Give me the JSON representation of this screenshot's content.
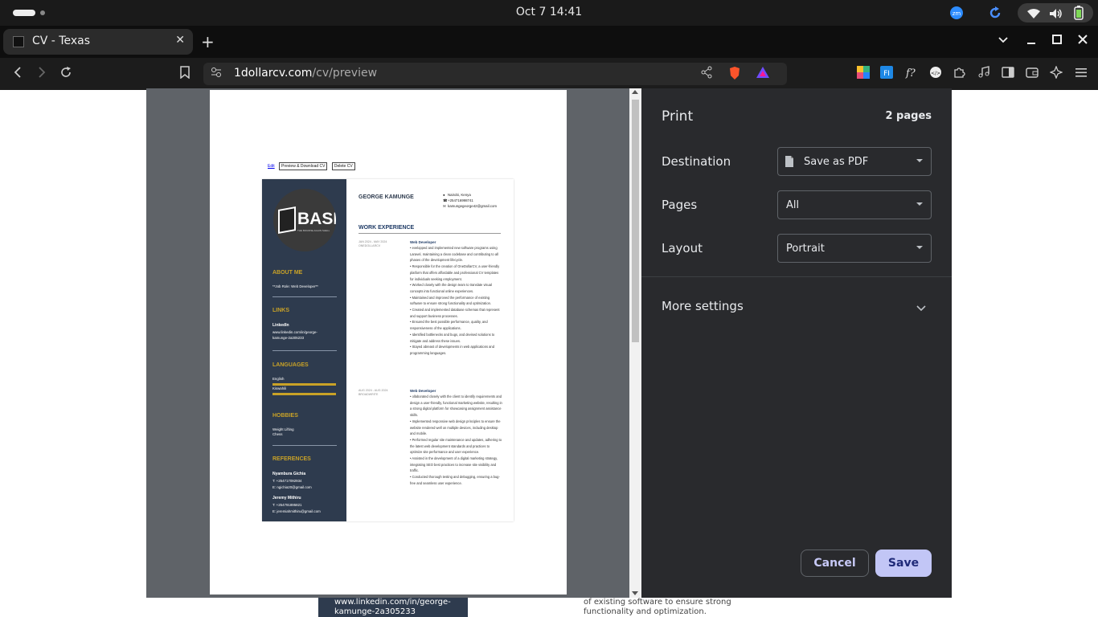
{
  "system": {
    "clock": "Oct 7  14:41",
    "tray": [
      "zoom-icon",
      "refresh-icon",
      "wifi-icon",
      "volume-icon",
      "battery-icon"
    ]
  },
  "browser": {
    "tab_title": "CV - Texas",
    "tab_close": "✕",
    "new_tab": "+",
    "url_domain": "1dollarcv.com",
    "url_path": "/cv/preview"
  },
  "print": {
    "title": "Print",
    "pages_count": "2 pages",
    "destination_label": "Destination",
    "destination_value": "Save as PDF",
    "pages_label": "Pages",
    "pages_value": "All",
    "layout_label": "Layout",
    "layout_value": "Portrait",
    "more_settings": "More settings",
    "cancel": "Cancel",
    "save": "Save"
  },
  "cv": {
    "toolbar": {
      "edit": "Edit",
      "preview": "Preview & Download CV",
      "delete": "Delete CV"
    },
    "logo_text": "BASI",
    "logo_sub": "THE BOURNE-AGAIN SHELL",
    "about_h": "ABOUT ME",
    "about_text": "**Job Role: Web Developer**",
    "links_h": "LINKS",
    "linkedin_h": "LinkedIn",
    "linkedin_url_1": "www.linkedin.com/in/george-",
    "linkedin_url_2": "kamunge-2a305233",
    "languages_h": "LANGUAGES",
    "lang_1": "English",
    "lang_2": "Kiswahili",
    "hobbies_h": "HOBBIES",
    "hobby_1": "Weight Lifting",
    "hobby_2": "Chess",
    "references_h": "REFERENCES",
    "ref1_name": "Nyambura Gichia",
    "ref1_t": "T: +254717092934",
    "ref1_e": "E: ngichia20@gmail.com",
    "ref2_name": "Jeremy Mithiru",
    "ref2_t": "T: +254791895821",
    "ref2_e": "E: jeremiahmithiru@gmail.com",
    "name": "GEORGE KAMUNGE",
    "location": "Nairobi, Kenya",
    "phone": "+254716998741",
    "email": "kamungegeorge42@gmail.com",
    "work_h": "WORK EXPERIENCE",
    "job1_date_1": "JAN 2024 - MAY 2024",
    "job1_date_2": "ONEDOLLARCV",
    "job1_title": "Web Developer",
    "job1_items": [
      "evelopped and implemented new software programs using Laravel, maintaining a clean codebase and contributing to all phases of the development lifecycle.",
      "Responsible for the creation of OneDollarCV, a user-friendly platform that offers affordable and professional CV templates for individuals seeking employment.",
      "Worked closely with the design team to translate visual concepts into functional online experiences.",
      "Maintained and improved the performance of existing software to ensure strong functionality and optimization.",
      "Created and implemented database schemas that represent and support business processes.",
      "Ensured the best possible performance, quality, and responsiveness of the applications.",
      "Identified bottlenecks and bugs, and devised solutions to mitigate and address these issues.",
      "Stayed abreast of developments in web applications and programming languages."
    ],
    "job2_date_1": "AUG 2024 - AUG 2024",
    "job2_date_2": "BROADWRITE",
    "job2_title": "Web Developer",
    "job2_items": [
      "ollaborated closely with the client to identify requirements and design a user-friendly, functional marketing website, resulting in a strong digital platform for showcasing assignment assistance skills.",
      "Implemented responsive web design principles to ensure the website rendered well on multiple devices, including desktop and mobile.",
      "Performed regular site maintenance and updates, adhering to the latest web development standards and practices to optimize site performance and user experience.",
      "Assisted in the development of a digital marketing strategy, integrating SEO best practices to increase site visibility and traffic.",
      "Conducted thorough testing and debugging, ensuring a bug-free and seamless user experience."
    ]
  },
  "background": {
    "left_line_1": "www.linkedin.com/in/george-",
    "left_line_2": "kamunge-2a305233",
    "right_line_1": "of existing software to ensure strong",
    "right_line_2": "functionality and optimization."
  }
}
